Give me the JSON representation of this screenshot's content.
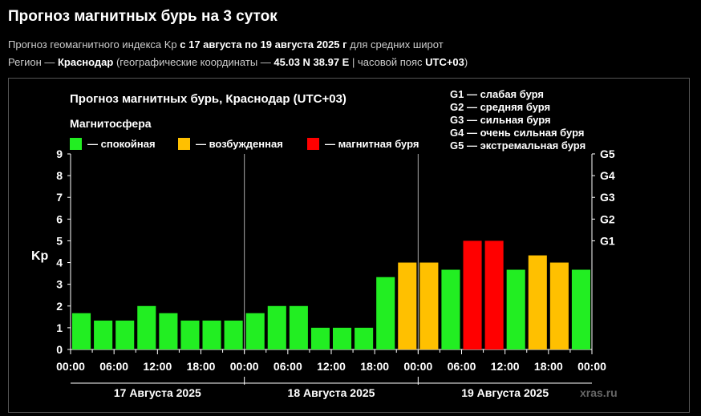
{
  "page": {
    "title": "Прогноз магнитных бурь на 3 суток",
    "line1_prefix": "Прогноз геомагнитного индекса Kp ",
    "line1_range": "с 17 августа по 19 августа 2025 г",
    "line1_suffix": " для средних широт",
    "line2_prefix": "Регион — ",
    "line2_region": "Краснодар",
    "line2_mid": " (географические координаты — ",
    "line2_coords": "45.03 N 38.97 E",
    "line2_tz_prefix": " | часовой пояс ",
    "line2_tz": "UTC+03",
    "line2_end": ")"
  },
  "chart_data": {
    "type": "bar",
    "title": "Прогноз магнитных бурь, Краснодар (UTC+03)",
    "legend_title": "Магнитосфера",
    "ylabel": "Kp",
    "ylim": [
      0,
      9
    ],
    "y_ticks": [
      "0",
      "1",
      "2",
      "3",
      "4",
      "5",
      "6",
      "7",
      "8",
      "9"
    ],
    "g_scale": [
      {
        "label": "G1",
        "kp": 5
      },
      {
        "label": "G2",
        "kp": 6
      },
      {
        "label": "G3",
        "kp": 7
      },
      {
        "label": "G4",
        "kp": 8
      },
      {
        "label": "G5",
        "kp": 9
      }
    ],
    "g_legend": [
      "G1 — слабая буря",
      "G2 — средняя буря",
      "G3 — сильная буря",
      "G4 — очень сильная буря",
      "G5 — экстремальная буря"
    ],
    "states": [
      {
        "label": "— спокойная",
        "color": "#22ee22"
      },
      {
        "label": "— возбужденная",
        "color": "#ffc000"
      },
      {
        "label": "— магнитная буря",
        "color": "#ff0000"
      }
    ],
    "x_tick_labels": [
      "00:00",
      "06:00",
      "12:00",
      "18:00",
      "00:00",
      "06:00",
      "12:00",
      "18:00",
      "00:00",
      "06:00",
      "12:00",
      "18:00",
      "00:00"
    ],
    "days": [
      "17 Августа 2025",
      "18 Августа 2025",
      "19 Августа 2025"
    ],
    "values": [
      1.67,
      1.33,
      1.33,
      2.0,
      1.67,
      1.33,
      1.33,
      1.33,
      1.67,
      2.0,
      2.0,
      1.0,
      1.0,
      1.0,
      3.33,
      4.0,
      4.0,
      3.67,
      5.0,
      5.0,
      3.67,
      4.33,
      4.0,
      3.67
    ],
    "watermark": "xras.ru"
  }
}
